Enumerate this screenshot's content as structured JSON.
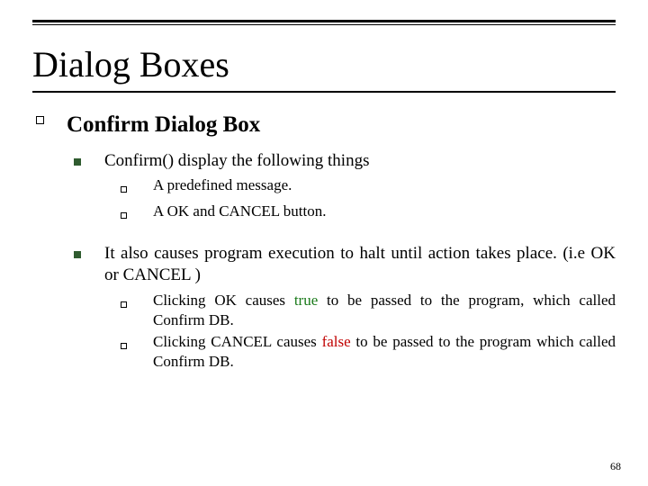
{
  "title": "Dialog Boxes",
  "section": {
    "heading": "Confirm Dialog Box",
    "items": [
      {
        "text": "Confirm() display the following things",
        "sub": [
          "A predefined message.",
          "A OK and CANCEL button."
        ]
      },
      {
        "text": "It also causes program execution to halt until action takes place. (i.e OK or CANCEL )",
        "sub_rich": [
          {
            "pre": "Clicking OK causes ",
            "em": "true",
            "em_class": "true",
            "post": " to be passed to the program, which called Confirm DB."
          },
          {
            "pre": "Clicking CANCEL causes ",
            "em": "false",
            "em_class": "false",
            "post": " to be passed to the program which called Confirm DB."
          }
        ]
      }
    ]
  },
  "page_number": "68"
}
